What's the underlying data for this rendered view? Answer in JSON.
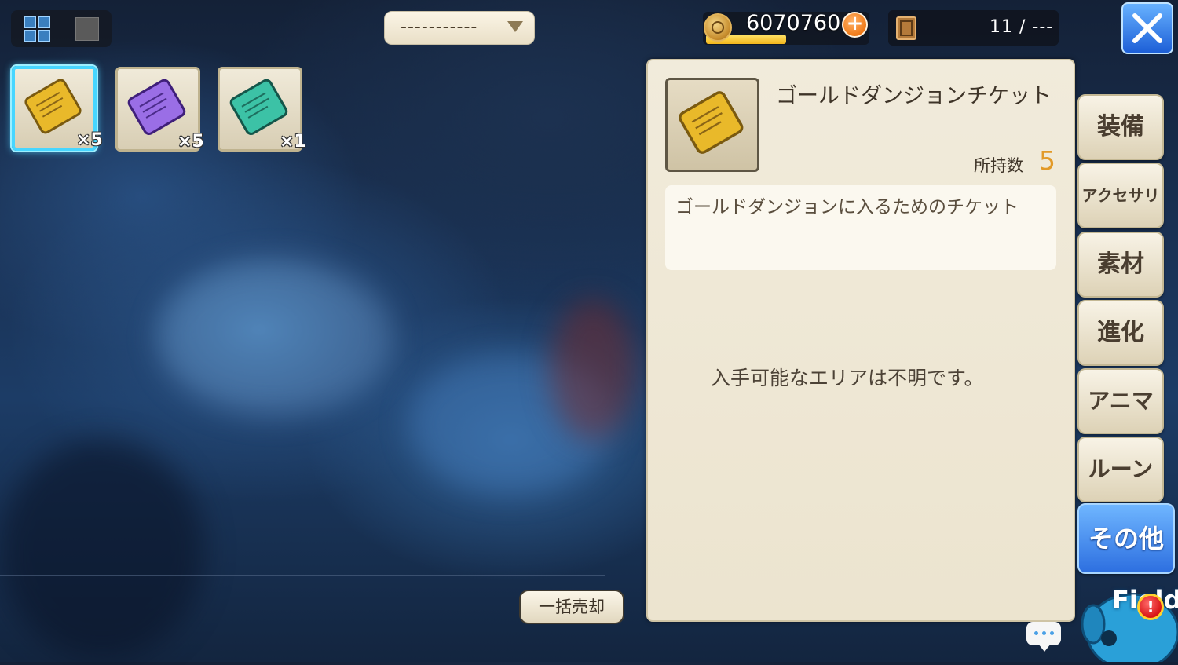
{
  "top_bar": {
    "dropdown_value": "-----------",
    "gold_amount": "6070760",
    "gold_plus": "+",
    "capacity": "11 / ---"
  },
  "items": [
    {
      "name": "gold-ticket",
      "count": "×5",
      "color": "#e9b92a"
    },
    {
      "name": "purple-ticket",
      "count": "×5",
      "color": "#9a6ee6"
    },
    {
      "name": "teal-ticket",
      "count": "×1",
      "color": "#3cc2a6"
    }
  ],
  "detail": {
    "item_name": "ゴールドダンジョンチケット",
    "quantity_label": "所持数",
    "quantity_value": "5",
    "description": "ゴールドダンジョンに入るためのチケット",
    "area_info": "入手可能なエリアは不明です。"
  },
  "tabs": [
    {
      "label": "装備"
    },
    {
      "label": "アクセサリ"
    },
    {
      "label": "素材"
    },
    {
      "label": "進化"
    },
    {
      "label": "アニマ"
    },
    {
      "label": "ルーン"
    },
    {
      "label": "その他",
      "active": true
    }
  ],
  "bulk_sell_label": "一括売却",
  "field_button": {
    "label": "Field",
    "alert": "!"
  },
  "colors": {
    "accent_blue": "#2d6fe0",
    "selected_border": "#47d6ff",
    "quantity_orange": "#e29a28"
  }
}
